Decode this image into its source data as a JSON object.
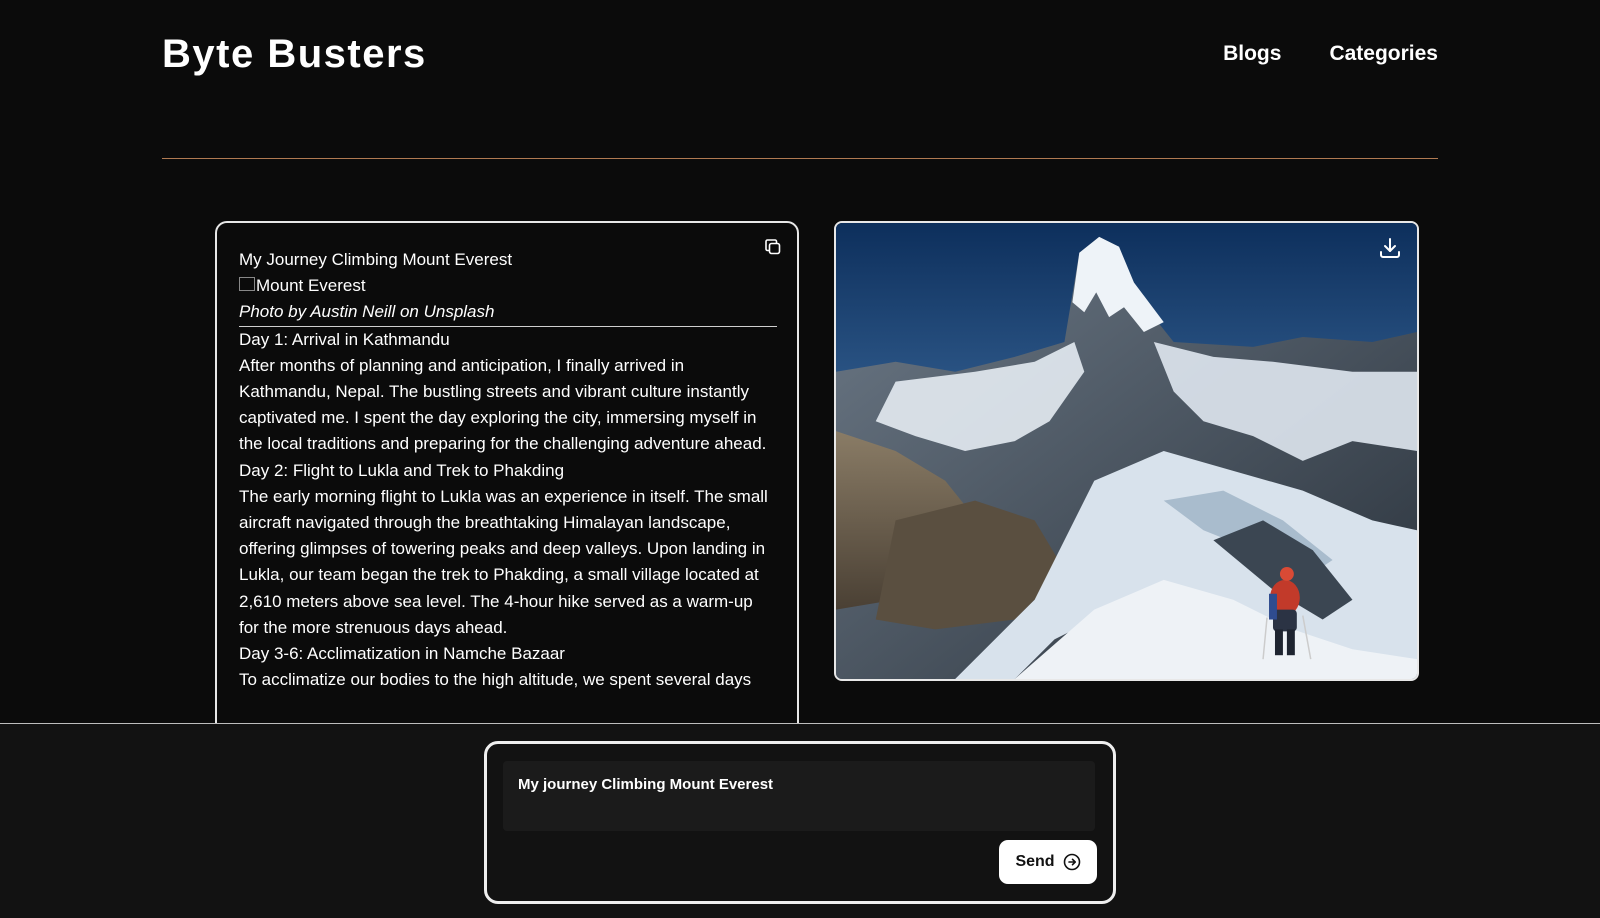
{
  "header": {
    "brand": "Byte Busters",
    "nav": [
      {
        "label": "Blogs"
      },
      {
        "label": "Categories"
      }
    ]
  },
  "article": {
    "title": "My Journey Climbing Mount Everest",
    "image_alt": "Mount Everest",
    "caption": "Photo by Austin Neill on Unsplash",
    "sections": [
      {
        "heading": "Day 1: Arrival in Kathmandu",
        "body": "After months of planning and anticipation, I finally arrived in Kathmandu, Nepal. The bustling streets and vibrant culture instantly captivated me. I spent the day exploring the city, immersing myself in the local traditions and preparing for the challenging adventure ahead."
      },
      {
        "heading": "Day 2: Flight to Lukla and Trek to Phakding",
        "body": "The early morning flight to Lukla was an experience in itself. The small aircraft navigated through the breathtaking Himalayan landscape, offering glimpses of towering peaks and deep valleys. Upon landing in Lukla, our team began the trek to Phakding, a small village located at 2,610 meters above sea level. The 4-hour hike served as a warm-up for the more strenuous days ahead."
      },
      {
        "heading": "Day 3-6: Acclimatization in Namche Bazaar",
        "body": "To acclimatize our bodies to the high altitude, we spent several days"
      }
    ]
  },
  "composer": {
    "prompt_value": "My journey Climbing Mount Everest",
    "send_label": "Send"
  },
  "icons": {
    "copy": "copy-icon",
    "download": "download-icon",
    "send": "arrow-right-circle-icon"
  }
}
